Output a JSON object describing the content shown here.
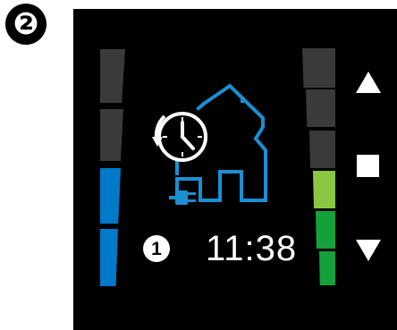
{
  "step_number": "❷",
  "display": {
    "mode_number": "1",
    "time": "11:38"
  },
  "left_bar": {
    "segments_total": 4,
    "segments_lit": 2,
    "lit_color": "#0079c9",
    "unlit_color": "#3a3a3a"
  },
  "right_bar": {
    "segments_total": 6,
    "segments_lit": 3,
    "colors": [
      "#14a03a",
      "#14a03a",
      "#8bc642",
      "#3a3a3a",
      "#3a3a3a",
      "#3a3a3a"
    ]
  },
  "icons": {
    "center": "house-clock-plug-icon",
    "up": "arrow-up-icon",
    "stop": "stop-icon",
    "down": "arrow-down-icon"
  },
  "colors": {
    "accent": "#1b8fd2",
    "screen_bg": "#000000"
  }
}
